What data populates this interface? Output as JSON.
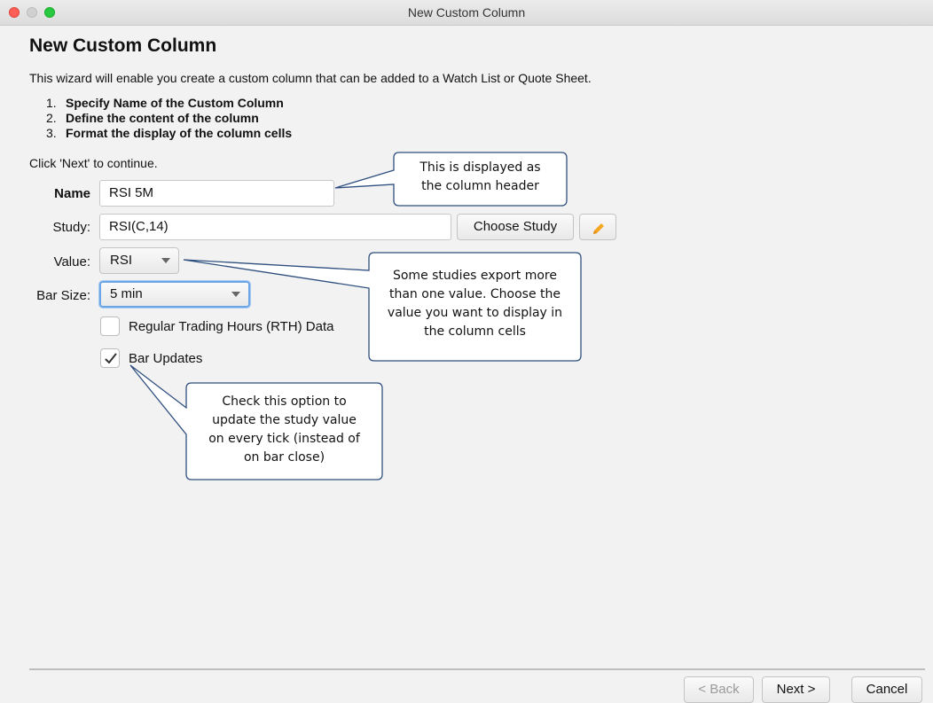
{
  "window": {
    "title": "New Custom Column"
  },
  "header": {
    "title": "New Custom Column",
    "intro": "This wizard will enable you create a custom column that can be added to a Watch List or Quote Sheet.",
    "steps": [
      {
        "num": "1.",
        "text": "Specify Name of the Custom Column"
      },
      {
        "num": "2.",
        "text": "Define the content of the column"
      },
      {
        "num": "3.",
        "text": "Format the display of the column cells"
      }
    ],
    "continue": "Click 'Next' to continue."
  },
  "form": {
    "name_label": "Name",
    "name_value": "RSI 5M",
    "study_label": "Study:",
    "study_value": "RSI(C,14)",
    "choose_study": "Choose Study",
    "value_label": "Value:",
    "value_selected": "RSI",
    "barsize_label": "Bar Size:",
    "barsize_selected": "5 min",
    "rth_label": "Regular Trading Hours (RTH) Data",
    "rth_checked": false,
    "bar_updates_label": "Bar Updates",
    "bar_updates_checked": true
  },
  "callouts": {
    "name_line1": "This is displayed as",
    "name_line2": "the column header",
    "value_line1": "Some studies export more",
    "value_line2": "than one value.  Choose the",
    "value_line3": "value you want to display in",
    "value_line4": "the column cells",
    "bar_line1": "Check this option to",
    "bar_line2": "update the study value",
    "bar_line3": "on every tick (instead of",
    "bar_line4": "on bar close)"
  },
  "footer": {
    "back": "< Back",
    "next": "Next >",
    "cancel": "Cancel"
  },
  "colors": {
    "callout_border": "#2f4f7f",
    "edit_icon": "#f5a623",
    "focus_ring": "#6aa6e8"
  }
}
